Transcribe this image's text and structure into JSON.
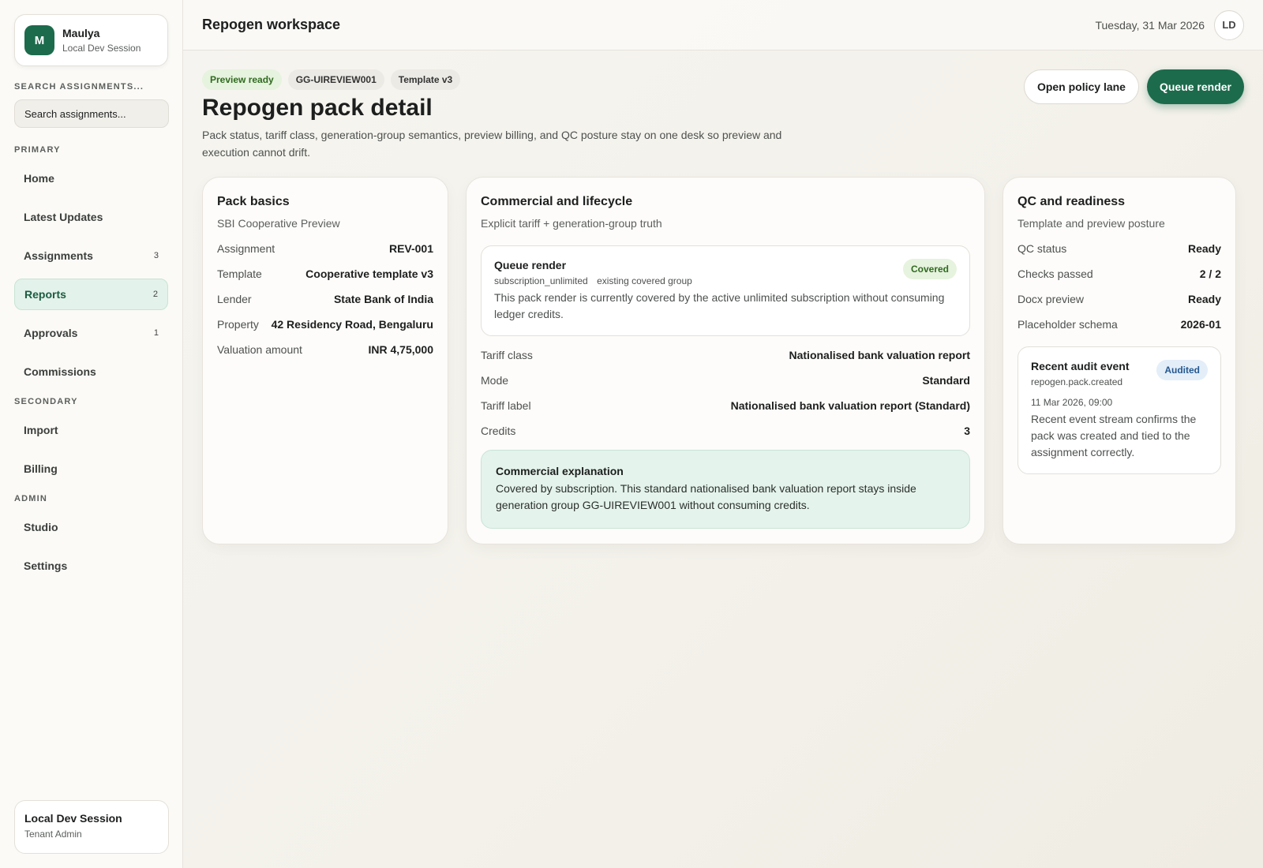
{
  "sidebar": {
    "user": {
      "initial": "M",
      "name": "Maulya",
      "session": "Local Dev Session"
    },
    "search": {
      "label": "SEARCH ASSIGNMENTS...",
      "placeholder": "Search assignments..."
    },
    "primary_label": "PRIMARY",
    "primary": [
      {
        "label": "Home",
        "count": ""
      },
      {
        "label": "Latest Updates",
        "count": ""
      },
      {
        "label": "Assignments",
        "count": "3"
      },
      {
        "label": "Reports",
        "count": "2"
      },
      {
        "label": "Approvals",
        "count": "1"
      },
      {
        "label": "Commissions",
        "count": ""
      }
    ],
    "secondary_label": "SECONDARY",
    "secondary": [
      {
        "label": "Import"
      },
      {
        "label": "Billing"
      }
    ],
    "admin_label": "ADMIN",
    "admin": [
      {
        "label": "Studio"
      },
      {
        "label": "Settings"
      }
    ],
    "session_card": {
      "title": "Local Dev Session",
      "role": "Tenant Admin"
    }
  },
  "topbar": {
    "title": "Repogen workspace",
    "date": "Tuesday, 31 Mar 2026",
    "avatar": "LD"
  },
  "header": {
    "chips": [
      "Preview ready",
      "GG-UIREVIEW001",
      "Template v3"
    ],
    "title": "Repogen pack detail",
    "description": "Pack status, tariff class, generation-group semantics, preview billing, and QC posture stay on one desk so preview and execution cannot drift.",
    "actions": {
      "secondary": "Open policy lane",
      "primary": "Queue render"
    }
  },
  "pack_basics": {
    "title": "Pack basics",
    "subtitle": "SBI Cooperative Preview",
    "rows": [
      {
        "k": "Assignment",
        "v": "REV-001"
      },
      {
        "k": "Template",
        "v": "Cooperative template v3"
      },
      {
        "k": "Lender",
        "v": "State Bank of India"
      },
      {
        "k": "Property",
        "v": "42 Residency Road, Bengaluru"
      },
      {
        "k": "Valuation amount",
        "v": "INR 4,75,000"
      }
    ]
  },
  "commercial": {
    "title": "Commercial and lifecycle",
    "subtitle": "Explicit tariff + generation-group truth",
    "queue": {
      "title": "Queue render",
      "meta1": "subscription_unlimited",
      "meta2": "existing covered group",
      "badge": "Covered",
      "desc": "This pack render is currently covered by the active unlimited subscription without consuming ledger credits."
    },
    "rows": [
      {
        "k": "Tariff class",
        "v": "Nationalised bank valuation report"
      },
      {
        "k": "Mode",
        "v": "Standard"
      },
      {
        "k": "Tariff label",
        "v": "Nationalised bank valuation report (Standard)"
      },
      {
        "k": "Credits",
        "v": "3"
      }
    ],
    "explanation": {
      "title": "Commercial explanation",
      "desc": "Covered by subscription. This standard nationalised bank valuation report stays inside generation group GG-UIREVIEW001 without consuming credits."
    }
  },
  "qc": {
    "title": "QC and readiness",
    "subtitle": "Template and preview posture",
    "rows": [
      {
        "k": "QC status",
        "v": "Ready"
      },
      {
        "k": "Checks passed",
        "v": "2 / 2"
      },
      {
        "k": "Docx preview",
        "v": "Ready"
      },
      {
        "k": "Placeholder schema",
        "v": "2026-01"
      }
    ],
    "audit": {
      "title": "Recent audit event",
      "event": "repogen.pack.created",
      "badge": "Audited",
      "date": "11 Mar 2026, 09:00",
      "desc": "Recent event stream confirms the pack was created and tied to the assignment correctly."
    }
  }
}
